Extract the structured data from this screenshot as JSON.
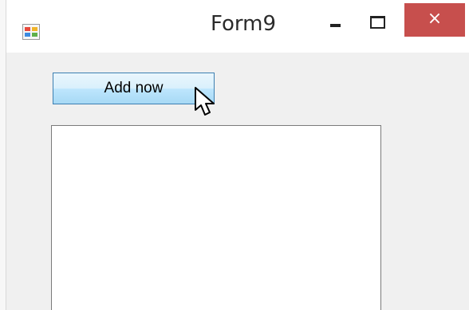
{
  "window": {
    "title": "Form9",
    "close_glyph": "×"
  },
  "toolbar": {
    "add_label": "Add now"
  },
  "listbox": {
    "items": []
  },
  "icons": {
    "app": "winforms-app-icon",
    "minimize": "minimize-icon",
    "maximize": "maximize-icon",
    "close": "close-icon",
    "cursor": "mouse-pointer-icon"
  },
  "colors": {
    "close_button": "#c74f4d",
    "button_border": "#3c7fb1",
    "button_face": "#d9f0fc",
    "form_background": "#f0f0f0"
  }
}
